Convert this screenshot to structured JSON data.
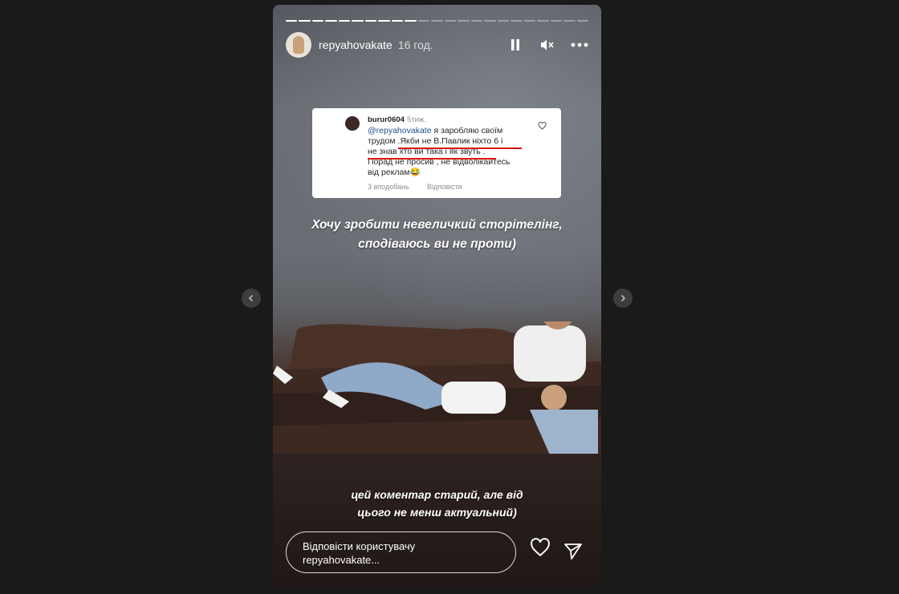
{
  "story": {
    "username": "repyahovakate",
    "time": "16 год.",
    "progress": {
      "total": 23,
      "done": 10
    },
    "icons": {
      "pause": "pause-icon",
      "mute": "mute-icon",
      "more": "more-icon"
    }
  },
  "comment": {
    "user": "burur0604",
    "ago": "5тиж.",
    "mention": "@repyahovakate",
    "line1": " я заробляю своїм",
    "line2": "трудом .Якби не В.Павлик ніхто б і",
    "line3": "не знав хто ви така і як звуть .",
    "line4": "Порад не просив , не відволікайтесь",
    "line5": "від реклам😂",
    "likes": "3 вподобань",
    "reply": "Відповісти"
  },
  "captions": {
    "top_line1": "Хочу зробити невеличкий сторітелінг,",
    "top_line2": "сподіваюсь ви не проти)",
    "bottom_line1": "цей коментар старий, але від",
    "bottom_line2": "цього не менш актуальний)"
  },
  "reply_box": {
    "line1": "Відповісти користувачу",
    "line2": "repyahovakate..."
  },
  "colors": {
    "background": "#1a1a1a",
    "mention": "#1d4e89",
    "underline": "#dd1111"
  }
}
